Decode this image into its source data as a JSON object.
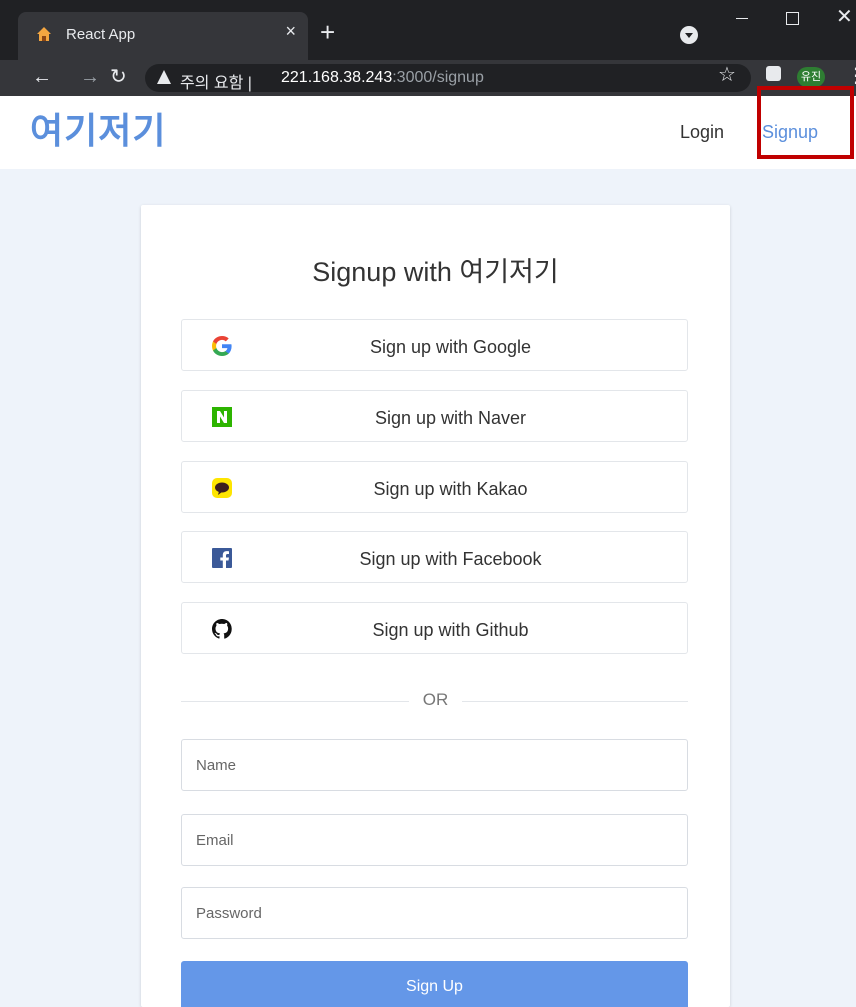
{
  "browser": {
    "tab_title": "React App",
    "tab_close": "×",
    "new_tab": "+",
    "security_label": "주의 요함",
    "url_host": "221.168.38.243",
    "url_rest": ":3000/signup",
    "separator": "|",
    "profile_initials": "유진",
    "icons": [
      "house-favicon-icon",
      "close-icon",
      "plus-icon",
      "back-arrow-icon",
      "forward-arrow-icon",
      "reload-icon",
      "warning-icon",
      "star-icon",
      "puzzle-icon",
      "kebab-menu-icon"
    ]
  },
  "header": {
    "logo": "여기저기",
    "login": "Login",
    "signup": "Signup",
    "accent_color": "#5b8fdc",
    "highlight_color": "#c00000"
  },
  "card": {
    "title": "Signup with 여기저기",
    "social": [
      {
        "label": "Sign up with Google",
        "icon": "google-icon"
      },
      {
        "label": "Sign up with Naver",
        "icon": "naver-icon"
      },
      {
        "label": "Sign up with Kakao",
        "icon": "kakao-icon"
      },
      {
        "label": "Sign up with Facebook",
        "icon": "facebook-icon"
      },
      {
        "label": "Sign up with Github",
        "icon": "github-icon"
      }
    ],
    "or": "OR",
    "fields": {
      "name_placeholder": "Name",
      "email_placeholder": "Email",
      "password_placeholder": "Password"
    },
    "submit": "Sign Up",
    "submit_color": "#6497e8"
  }
}
